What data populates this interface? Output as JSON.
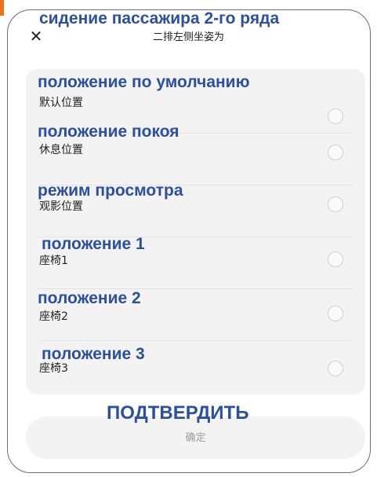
{
  "dialog": {
    "title": "二排左侧坐姿为",
    "title_overlay": "сидение пассажира 2-го ряда",
    "close_icon": "close-icon",
    "close_glyph": "✕"
  },
  "options": [
    {
      "label": "默认位置",
      "overlay": "положение по умолчанию",
      "selected": false
    },
    {
      "label": "休息位置",
      "overlay": "положение покоя",
      "selected": false
    },
    {
      "label": "观影位置",
      "overlay": "режим просмотра",
      "selected": false
    },
    {
      "label": "座椅1",
      "overlay": "положение 1",
      "selected": false
    },
    {
      "label": "座椅2",
      "overlay": "положение 2",
      "selected": false
    },
    {
      "label": "座椅3",
      "overlay": "положение 3",
      "selected": false
    }
  ],
  "confirm": {
    "label": "确定",
    "overlay": "ПОДТВЕРДИТЬ"
  },
  "colors": {
    "overlay_text": "#2b4fa3",
    "accent_mark": "#e8731c",
    "panel_background": "#f3f3f3",
    "radio_border": "#cfcfcf"
  }
}
